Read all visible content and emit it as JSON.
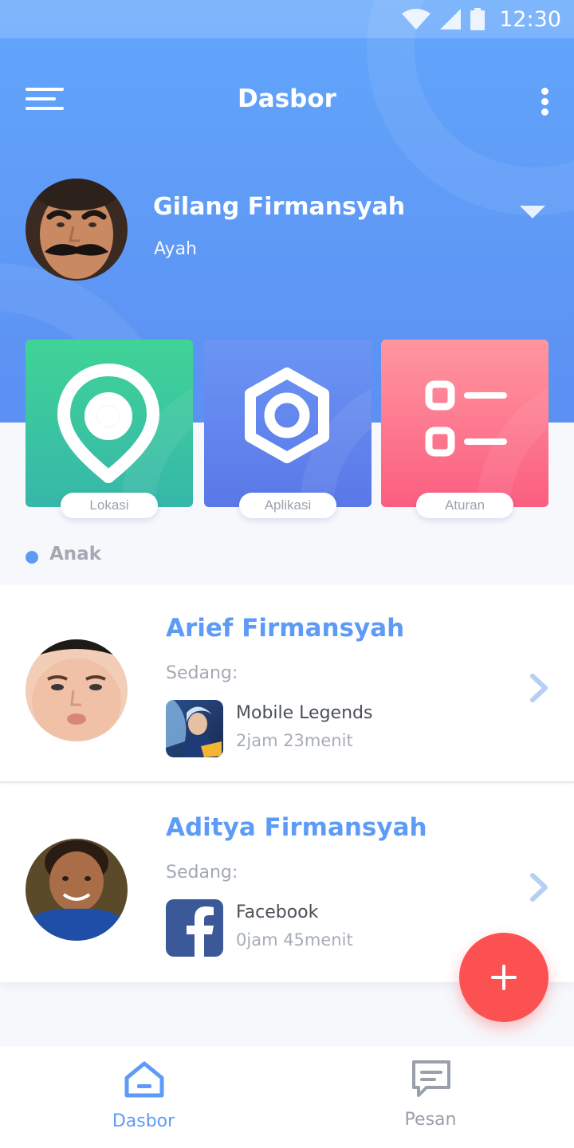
{
  "status_bar": {
    "time": "12:30"
  },
  "header": {
    "title": "Dasbor"
  },
  "profile": {
    "name": "Gilang Firmansyah",
    "role": "Ayah"
  },
  "tiles": [
    {
      "label": "Lokasi",
      "icon": "location-pin-icon",
      "color": "#3cc69d"
    },
    {
      "label": "Aplikasi",
      "icon": "hexagon-app-icon",
      "color": "#6287ee"
    },
    {
      "label": "Aturan",
      "icon": "rules-list-icon",
      "color": "#fd7890"
    }
  ],
  "section": {
    "title": "Anak"
  },
  "children": [
    {
      "name": "Arief Firmansyah",
      "status_label": "Sedang:",
      "app": "Mobile Legends",
      "duration": "2jam 23menit",
      "app_icon": "mobile-legends-icon"
    },
    {
      "name": "Aditya Firmansyah",
      "status_label": "Sedang:",
      "app": "Facebook",
      "duration": "0jam 45menit",
      "app_icon": "facebook-icon"
    }
  ],
  "fab": {
    "icon": "plus-icon",
    "color": "#fb5151"
  },
  "bottom_nav": [
    {
      "label": "Dasbor",
      "icon": "home-icon",
      "active": true
    },
    {
      "label": "Pesan",
      "icon": "message-icon",
      "active": false
    }
  ],
  "colors": {
    "primary": "#5e9bf6",
    "accent": "#fb5151"
  }
}
